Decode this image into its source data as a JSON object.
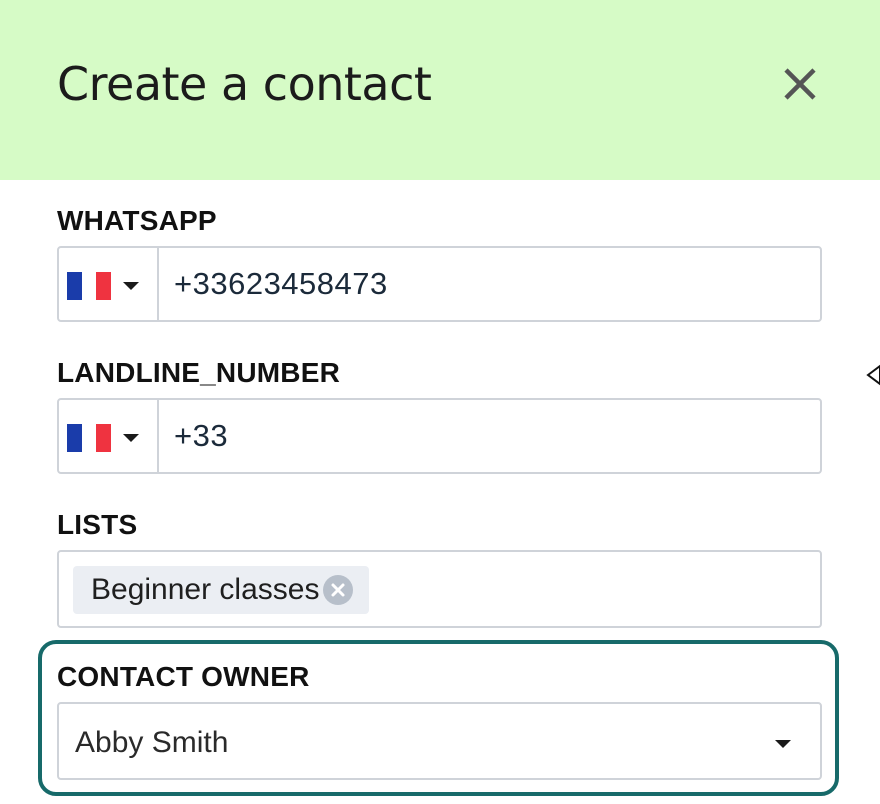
{
  "dialog": {
    "title": "Create a contact",
    "close_icon": "close-icon"
  },
  "fields": {
    "whatsapp": {
      "label": "WHATSAPP",
      "country_flag": "france-flag-icon",
      "value": "+33623458473"
    },
    "landline": {
      "label": "LANDLINE_NUMBER",
      "country_flag": "france-flag-icon",
      "value": "+33"
    },
    "lists": {
      "label": "LISTS",
      "tags": [
        {
          "label": "Beginner classes"
        }
      ]
    },
    "contact_owner": {
      "label": "CONTACT OWNER",
      "value": "Abby Smith"
    }
  },
  "colors": {
    "header_bg": "#d6fbc6",
    "focus_ring": "#176a6a",
    "border": "#cfd3d9"
  }
}
